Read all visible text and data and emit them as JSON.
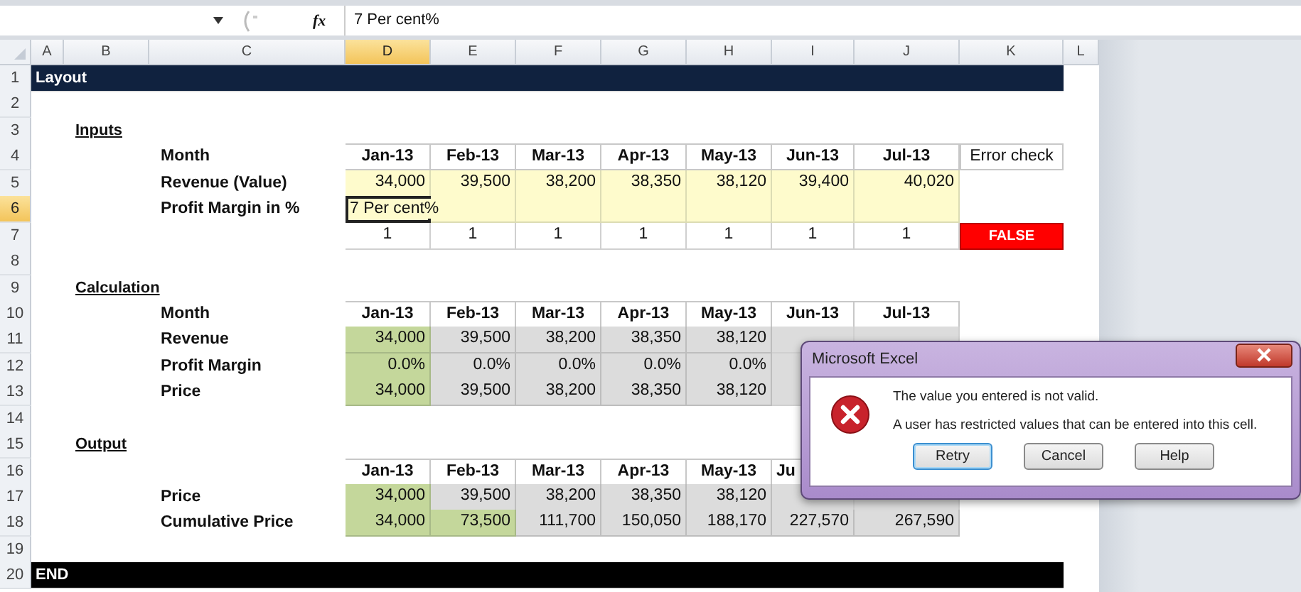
{
  "formula_bar": {
    "function_label": "fx",
    "value": "7 Per cent%"
  },
  "sheet": {
    "columns": [
      {
        "label": "A",
        "selected": false
      },
      {
        "label": "B",
        "selected": false
      },
      {
        "label": "C",
        "selected": false
      },
      {
        "label": "D",
        "selected": true
      },
      {
        "label": "E",
        "selected": false
      },
      {
        "label": "F",
        "selected": false
      },
      {
        "label": "G",
        "selected": false
      },
      {
        "label": "H",
        "selected": false
      },
      {
        "label": "I",
        "selected": false
      },
      {
        "label": "J",
        "selected": false
      },
      {
        "label": "K",
        "selected": false
      },
      {
        "label": "L",
        "selected": false
      }
    ],
    "rows": [
      {
        "number": "1",
        "selected": false,
        "kind": "banner",
        "text": "Layout",
        "color": "#10223f"
      },
      {
        "number": "2",
        "selected": false,
        "kind": "blank"
      },
      {
        "number": "3",
        "selected": false,
        "kind": "section",
        "text": "Inputs"
      },
      {
        "number": "4",
        "selected": false,
        "kind": "data",
        "label": "Month",
        "cells": [
          {
            "kind": "header",
            "text": "Jan-13"
          },
          {
            "kind": "header",
            "text": "Feb-13"
          },
          {
            "kind": "header",
            "text": "Mar-13"
          },
          {
            "kind": "header",
            "text": "Apr-13"
          },
          {
            "kind": "header",
            "text": "May-13"
          },
          {
            "kind": "header",
            "text": "Jun-13"
          },
          {
            "kind": "header",
            "text": "Jul-13"
          },
          {
            "kind": "boxed",
            "text": "Error check"
          }
        ]
      },
      {
        "number": "5",
        "selected": false,
        "kind": "data",
        "label": "Revenue (Value)",
        "cells": [
          {
            "kind": "input",
            "text": "34,000"
          },
          {
            "kind": "input",
            "text": "39,500"
          },
          {
            "kind": "input",
            "text": "38,200"
          },
          {
            "kind": "input",
            "text": "38,350"
          },
          {
            "kind": "input",
            "text": "38,120"
          },
          {
            "kind": "input",
            "text": "39,400"
          },
          {
            "kind": "input",
            "text": "40,020"
          },
          {
            "kind": "none"
          }
        ]
      },
      {
        "number": "6",
        "selected": true,
        "kind": "data",
        "label": "Profit Margin in %",
        "cells": [
          {
            "kind": "active",
            "text": "7 Per cent%"
          },
          {
            "kind": "input"
          },
          {
            "kind": "input"
          },
          {
            "kind": "input"
          },
          {
            "kind": "input"
          },
          {
            "kind": "input"
          },
          {
            "kind": "input"
          },
          {
            "kind": "none"
          }
        ]
      },
      {
        "number": "7",
        "selected": false,
        "kind": "data",
        "cells": [
          {
            "kind": "plain",
            "text": "1"
          },
          {
            "kind": "plain",
            "text": "1"
          },
          {
            "kind": "plain",
            "text": "1"
          },
          {
            "kind": "plain",
            "text": "1"
          },
          {
            "kind": "plain",
            "text": "1"
          },
          {
            "kind": "plain",
            "text": "1"
          },
          {
            "kind": "plain",
            "text": "1"
          },
          {
            "kind": "error",
            "text": "FALSE"
          }
        ]
      },
      {
        "number": "8",
        "selected": false,
        "kind": "blank"
      },
      {
        "number": "9",
        "selected": false,
        "kind": "section",
        "text": "Calculation"
      },
      {
        "number": "10",
        "selected": false,
        "kind": "data",
        "label": "Month",
        "cells": [
          {
            "kind": "header",
            "text": "Jan-13"
          },
          {
            "kind": "header",
            "text": "Feb-13"
          },
          {
            "kind": "header",
            "text": "Mar-13"
          },
          {
            "kind": "header",
            "text": "Apr-13"
          },
          {
            "kind": "header",
            "text": "May-13"
          },
          {
            "kind": "header",
            "text": "Jun-13"
          },
          {
            "kind": "header",
            "text": "Jul-13"
          },
          {
            "kind": "none"
          }
        ]
      },
      {
        "number": "11",
        "selected": false,
        "kind": "data",
        "label": "Revenue",
        "cells": [
          {
            "kind": "green",
            "text": "34,000"
          },
          {
            "kind": "grey",
            "text": "39,500"
          },
          {
            "kind": "grey",
            "text": "38,200"
          },
          {
            "kind": "grey",
            "text": "38,350"
          },
          {
            "kind": "grey",
            "text": "38,120"
          },
          {
            "kind": "covered"
          },
          {
            "kind": "covered"
          },
          {
            "kind": "none"
          }
        ]
      },
      {
        "number": "12",
        "selected": false,
        "kind": "data",
        "label": "Profit Margin",
        "cells": [
          {
            "kind": "green",
            "text": "0.0%"
          },
          {
            "kind": "grey",
            "text": "0.0%"
          },
          {
            "kind": "grey",
            "text": "0.0%"
          },
          {
            "kind": "grey",
            "text": "0.0%"
          },
          {
            "kind": "grey",
            "text": "0.0%"
          },
          {
            "kind": "covered"
          },
          {
            "kind": "none"
          },
          {
            "kind": "none"
          }
        ]
      },
      {
        "number": "13",
        "selected": false,
        "kind": "data",
        "label": "Price",
        "cells": [
          {
            "kind": "green",
            "text": "34,000"
          },
          {
            "kind": "grey",
            "text": "39,500"
          },
          {
            "kind": "grey",
            "text": "38,200"
          },
          {
            "kind": "grey",
            "text": "38,350"
          },
          {
            "kind": "grey",
            "text": "38,120"
          },
          {
            "kind": "covered"
          },
          {
            "kind": "none"
          },
          {
            "kind": "none"
          }
        ]
      },
      {
        "number": "14",
        "selected": false,
        "kind": "blank"
      },
      {
        "number": "15",
        "selected": false,
        "kind": "section",
        "text": "Output"
      },
      {
        "number": "16",
        "selected": false,
        "kind": "data",
        "cells": [
          {
            "kind": "header",
            "text": "Jan-13"
          },
          {
            "kind": "header",
            "text": "Feb-13"
          },
          {
            "kind": "header",
            "text": "Mar-13"
          },
          {
            "kind": "header",
            "text": "Apr-13"
          },
          {
            "kind": "header",
            "text": "May-13"
          },
          {
            "kind": "partial",
            "text": "Ju"
          },
          {
            "kind": "none"
          },
          {
            "kind": "none"
          }
        ]
      },
      {
        "number": "17",
        "selected": false,
        "kind": "data",
        "label": "Price",
        "cells": [
          {
            "kind": "green",
            "text": "34,000"
          },
          {
            "kind": "grey",
            "text": "39,500"
          },
          {
            "kind": "grey",
            "text": "38,200"
          },
          {
            "kind": "grey",
            "text": "38,350"
          },
          {
            "kind": "grey",
            "text": "38,120"
          },
          {
            "kind": "covered"
          },
          {
            "kind": "covered"
          },
          {
            "kind": "none"
          }
        ]
      },
      {
        "number": "18",
        "selected": false,
        "kind": "data",
        "label": "Cumulative Price",
        "cells": [
          {
            "kind": "green",
            "text": "34,000"
          },
          {
            "kind": "green",
            "text": "73,500"
          },
          {
            "kind": "grey",
            "text": "111,700"
          },
          {
            "kind": "grey",
            "text": "150,050"
          },
          {
            "kind": "grey",
            "text": "188,170"
          },
          {
            "kind": "grey",
            "text": "227,570"
          },
          {
            "kind": "grey",
            "text": "267,590"
          },
          {
            "kind": "none"
          }
        ]
      },
      {
        "number": "19",
        "selected": false,
        "kind": "blank"
      },
      {
        "number": "20",
        "selected": false,
        "kind": "banner",
        "text": "END",
        "color": "#000000"
      }
    ]
  },
  "dialog": {
    "title": "Microsoft Excel",
    "message": "The value you entered is not valid.",
    "detail": "A user has restricted values that can be entered into this cell.",
    "buttons": [
      {
        "label": "Retry",
        "default": true
      },
      {
        "label": "Cancel",
        "default": false
      },
      {
        "label": "Help",
        "default": false
      }
    ]
  }
}
